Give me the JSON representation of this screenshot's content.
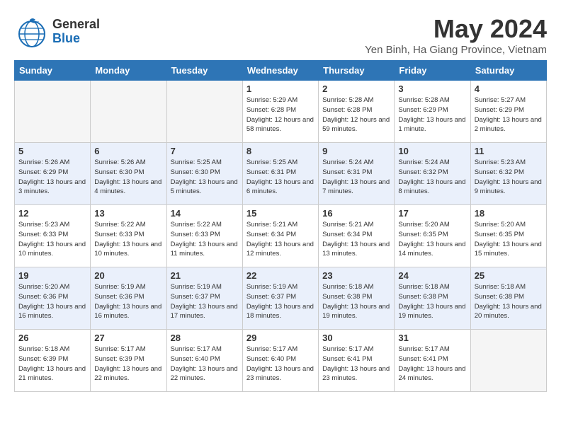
{
  "header": {
    "logo_line1": "General",
    "logo_line2": "Blue",
    "title": "May 2024",
    "subtitle": "Yen Binh, Ha Giang Province, Vietnam"
  },
  "weekdays": [
    "Sunday",
    "Monday",
    "Tuesday",
    "Wednesday",
    "Thursday",
    "Friday",
    "Saturday"
  ],
  "weeks": [
    [
      {
        "day": "",
        "empty": true
      },
      {
        "day": "",
        "empty": true
      },
      {
        "day": "",
        "empty": true
      },
      {
        "day": "1",
        "sunrise": "5:29 AM",
        "sunset": "6:28 PM",
        "daylight": "12 hours and 58 minutes."
      },
      {
        "day": "2",
        "sunrise": "5:28 AM",
        "sunset": "6:28 PM",
        "daylight": "12 hours and 59 minutes."
      },
      {
        "day": "3",
        "sunrise": "5:28 AM",
        "sunset": "6:29 PM",
        "daylight": "13 hours and 1 minute."
      },
      {
        "day": "4",
        "sunrise": "5:27 AM",
        "sunset": "6:29 PM",
        "daylight": "13 hours and 2 minutes."
      }
    ],
    [
      {
        "day": "5",
        "sunrise": "5:26 AM",
        "sunset": "6:29 PM",
        "daylight": "13 hours and 3 minutes."
      },
      {
        "day": "6",
        "sunrise": "5:26 AM",
        "sunset": "6:30 PM",
        "daylight": "13 hours and 4 minutes."
      },
      {
        "day": "7",
        "sunrise": "5:25 AM",
        "sunset": "6:30 PM",
        "daylight": "13 hours and 5 minutes."
      },
      {
        "day": "8",
        "sunrise": "5:25 AM",
        "sunset": "6:31 PM",
        "daylight": "13 hours and 6 minutes."
      },
      {
        "day": "9",
        "sunrise": "5:24 AM",
        "sunset": "6:31 PM",
        "daylight": "13 hours and 7 minutes."
      },
      {
        "day": "10",
        "sunrise": "5:24 AM",
        "sunset": "6:32 PM",
        "daylight": "13 hours and 8 minutes."
      },
      {
        "day": "11",
        "sunrise": "5:23 AM",
        "sunset": "6:32 PM",
        "daylight": "13 hours and 9 minutes."
      }
    ],
    [
      {
        "day": "12",
        "sunrise": "5:23 AM",
        "sunset": "6:33 PM",
        "daylight": "13 hours and 10 minutes."
      },
      {
        "day": "13",
        "sunrise": "5:22 AM",
        "sunset": "6:33 PM",
        "daylight": "13 hours and 10 minutes."
      },
      {
        "day": "14",
        "sunrise": "5:22 AM",
        "sunset": "6:33 PM",
        "daylight": "13 hours and 11 minutes."
      },
      {
        "day": "15",
        "sunrise": "5:21 AM",
        "sunset": "6:34 PM",
        "daylight": "13 hours and 12 minutes."
      },
      {
        "day": "16",
        "sunrise": "5:21 AM",
        "sunset": "6:34 PM",
        "daylight": "13 hours and 13 minutes."
      },
      {
        "day": "17",
        "sunrise": "5:20 AM",
        "sunset": "6:35 PM",
        "daylight": "13 hours and 14 minutes."
      },
      {
        "day": "18",
        "sunrise": "5:20 AM",
        "sunset": "6:35 PM",
        "daylight": "13 hours and 15 minutes."
      }
    ],
    [
      {
        "day": "19",
        "sunrise": "5:20 AM",
        "sunset": "6:36 PM",
        "daylight": "13 hours and 16 minutes."
      },
      {
        "day": "20",
        "sunrise": "5:19 AM",
        "sunset": "6:36 PM",
        "daylight": "13 hours and 16 minutes."
      },
      {
        "day": "21",
        "sunrise": "5:19 AM",
        "sunset": "6:37 PM",
        "daylight": "13 hours and 17 minutes."
      },
      {
        "day": "22",
        "sunrise": "5:19 AM",
        "sunset": "6:37 PM",
        "daylight": "13 hours and 18 minutes."
      },
      {
        "day": "23",
        "sunrise": "5:18 AM",
        "sunset": "6:38 PM",
        "daylight": "13 hours and 19 minutes."
      },
      {
        "day": "24",
        "sunrise": "5:18 AM",
        "sunset": "6:38 PM",
        "daylight": "13 hours and 19 minutes."
      },
      {
        "day": "25",
        "sunrise": "5:18 AM",
        "sunset": "6:38 PM",
        "daylight": "13 hours and 20 minutes."
      }
    ],
    [
      {
        "day": "26",
        "sunrise": "5:18 AM",
        "sunset": "6:39 PM",
        "daylight": "13 hours and 21 minutes."
      },
      {
        "day": "27",
        "sunrise": "5:17 AM",
        "sunset": "6:39 PM",
        "daylight": "13 hours and 22 minutes."
      },
      {
        "day": "28",
        "sunrise": "5:17 AM",
        "sunset": "6:40 PM",
        "daylight": "13 hours and 22 minutes."
      },
      {
        "day": "29",
        "sunrise": "5:17 AM",
        "sunset": "6:40 PM",
        "daylight": "13 hours and 23 minutes."
      },
      {
        "day": "30",
        "sunrise": "5:17 AM",
        "sunset": "6:41 PM",
        "daylight": "13 hours and 23 minutes."
      },
      {
        "day": "31",
        "sunrise": "5:17 AM",
        "sunset": "6:41 PM",
        "daylight": "13 hours and 24 minutes."
      },
      {
        "day": "",
        "empty": true
      }
    ]
  ]
}
